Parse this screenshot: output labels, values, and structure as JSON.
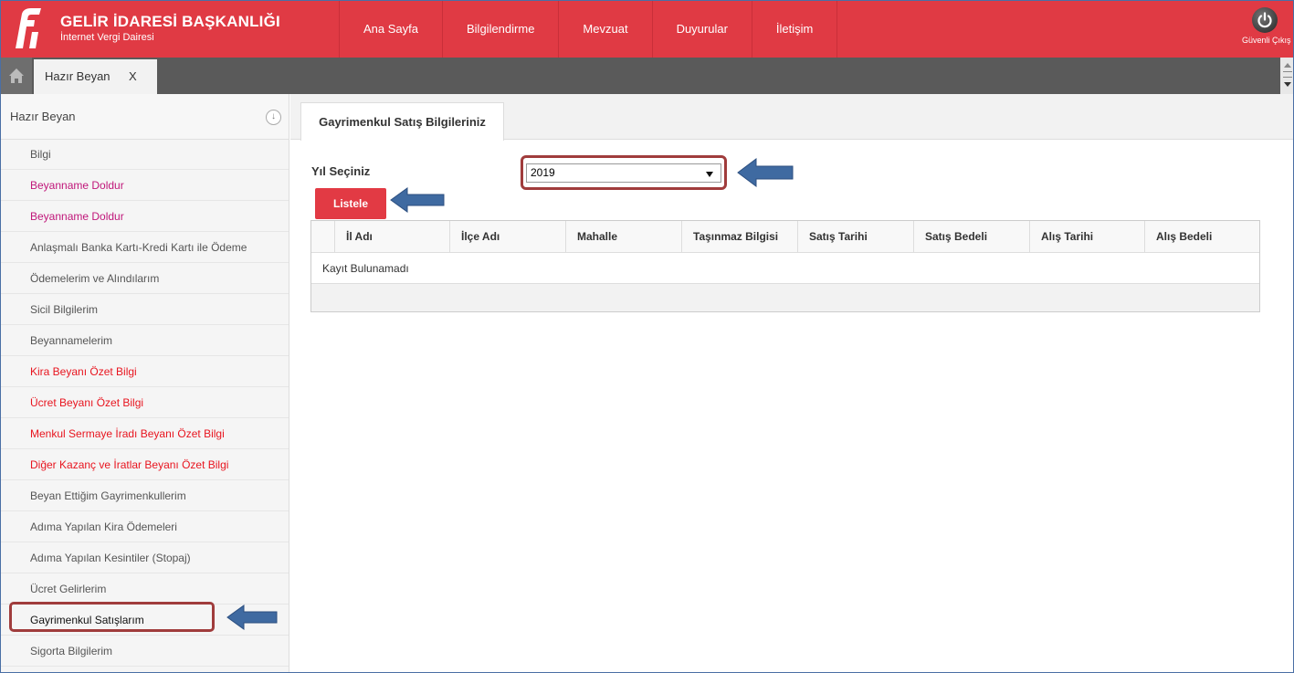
{
  "header": {
    "title": "GELİR İDARESİ BAŞKANLIĞI",
    "subtitle": "İnternet Vergi Dairesi",
    "nav": [
      "Ana Sayfa",
      "Bilgilendirme",
      "Mevzuat",
      "Duyurular",
      "İletişim"
    ],
    "logout_label": "Güvenli Çıkış"
  },
  "tabstrip": {
    "open_tab_label": "Hazır Beyan",
    "close_label": "X"
  },
  "sidebar": {
    "title": "Hazır Beyan",
    "toggle_glyph": "↓",
    "items": [
      {
        "label": "Bilgi",
        "color": "#555555"
      },
      {
        "label": "Beyanname Doldur",
        "color": "#c0177a"
      },
      {
        "label": "Beyanname Doldur",
        "color": "#c0177a"
      },
      {
        "label": "Anlaşmalı Banka Kartı-Kredi Kartı ile Ödeme",
        "color": "#555555"
      },
      {
        "label": "Ödemelerim ve Alındılarım",
        "color": "#555555"
      },
      {
        "label": "Sicil Bilgilerim",
        "color": "#555555"
      },
      {
        "label": "Beyannamelerim",
        "color": "#555555"
      },
      {
        "label": "Kira Beyanı Özet Bilgi",
        "color": "#e8151f"
      },
      {
        "label": "Ücret Beyanı Özet Bilgi",
        "color": "#e8151f"
      },
      {
        "label": "Menkul Sermaye İradı Beyanı Özet Bilgi",
        "color": "#e8151f"
      },
      {
        "label": "Diğer Kazanç ve İratlar Beyanı Özet Bilgi",
        "color": "#e8151f"
      },
      {
        "label": "Beyan Ettiğim Gayrimenkullerim",
        "color": "#555555"
      },
      {
        "label": "Adıma Yapılan Kira Ödemeleri",
        "color": "#555555"
      },
      {
        "label": "Adıma Yapılan Kesintiler (Stopaj)",
        "color": "#555555"
      },
      {
        "label": "Ücret Gelirlerim",
        "color": "#555555"
      },
      {
        "label": "Gayrimenkul Satışlarım",
        "color": "#111111"
      },
      {
        "label": "Sigorta Bilgilerim",
        "color": "#555555"
      }
    ]
  },
  "main": {
    "tab_label": "Gayrimenkul Satış Bilgileriniz",
    "year_label": "Yıl Seçiniz",
    "year_value": "2019",
    "list_button": "Listele",
    "table": {
      "columns": [
        "İl Adı",
        "İlçe Adı",
        "Mahalle",
        "Taşınmaz Bilgisi",
        "Satış Tarihi",
        "Satış Bedeli",
        "Alış Tarihi",
        "Alış Bedeli"
      ],
      "empty_message": "Kayıt Bulunamadı"
    }
  },
  "colors": {
    "brand_red": "#e03a44",
    "highlight_border": "#a03c3c",
    "arrow_blue": "#3f6aa1"
  },
  "icons": [
    "logo-icon",
    "power-icon",
    "home-icon",
    "arrow-icon"
  ]
}
